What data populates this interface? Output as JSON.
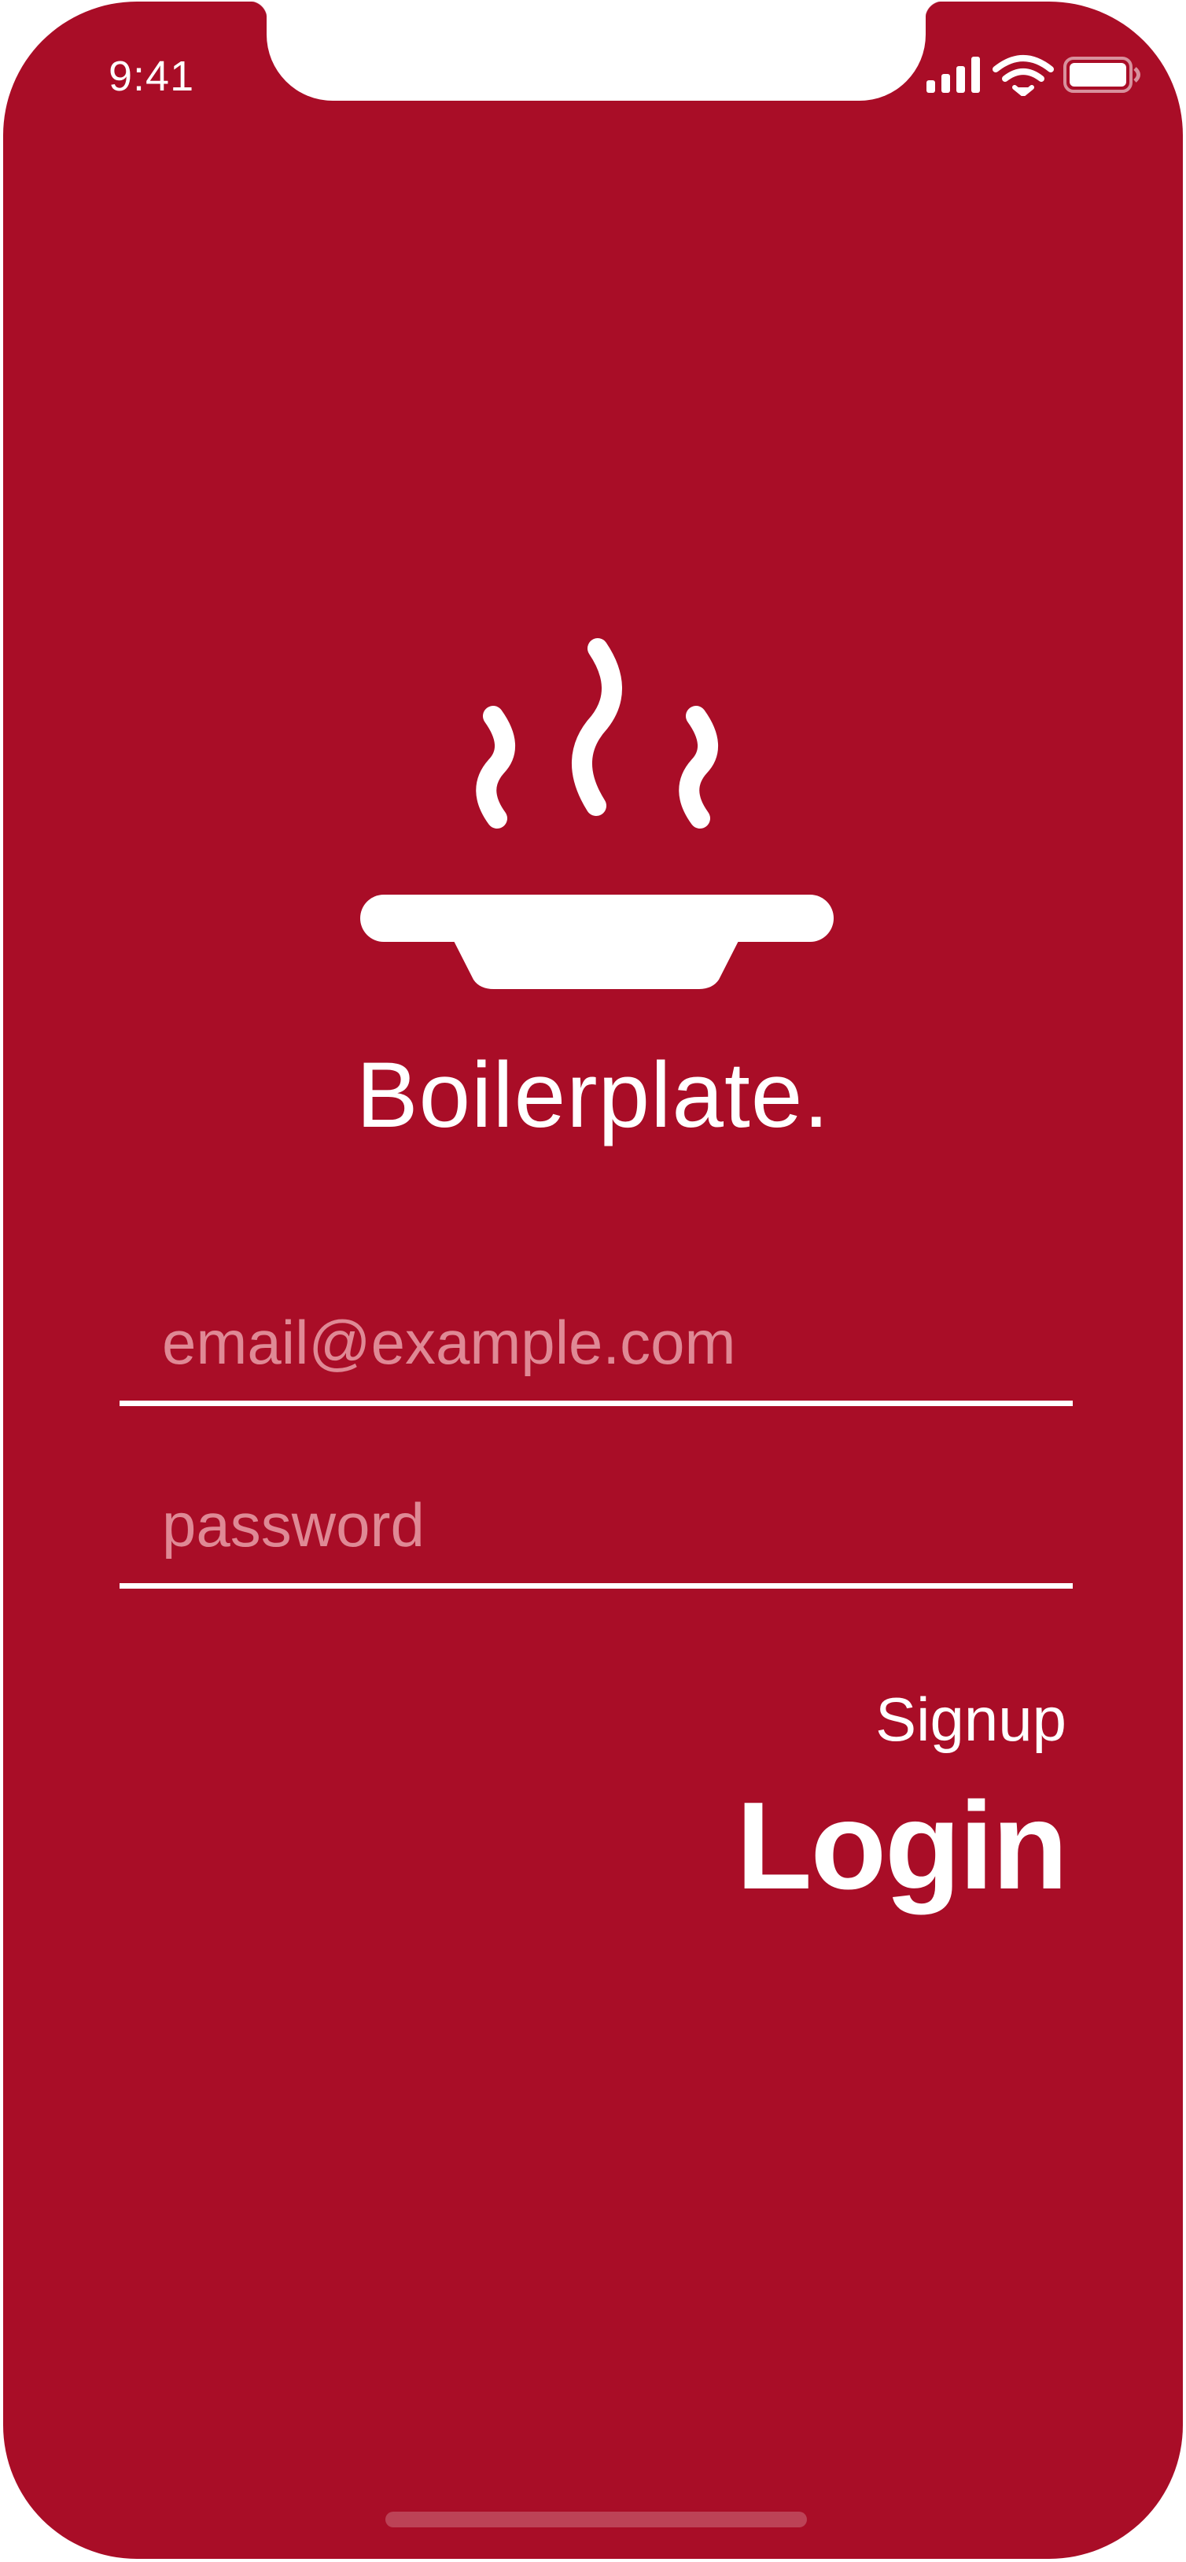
{
  "status_bar": {
    "time": "9:41",
    "icons": [
      "cellular-signal-icon",
      "wifi-icon",
      "battery-icon"
    ]
  },
  "app": {
    "logo_icon": "steaming-bowl-icon",
    "title": "Boilerplate."
  },
  "form": {
    "email_placeholder": "email@example.com",
    "email_value": "",
    "password_placeholder": "password",
    "password_value": ""
  },
  "actions": {
    "signup_label": "Signup",
    "login_label": "Login"
  },
  "colors": {
    "background": "#a90d27",
    "foreground": "#ffffff",
    "placeholder": "#df8995"
  }
}
